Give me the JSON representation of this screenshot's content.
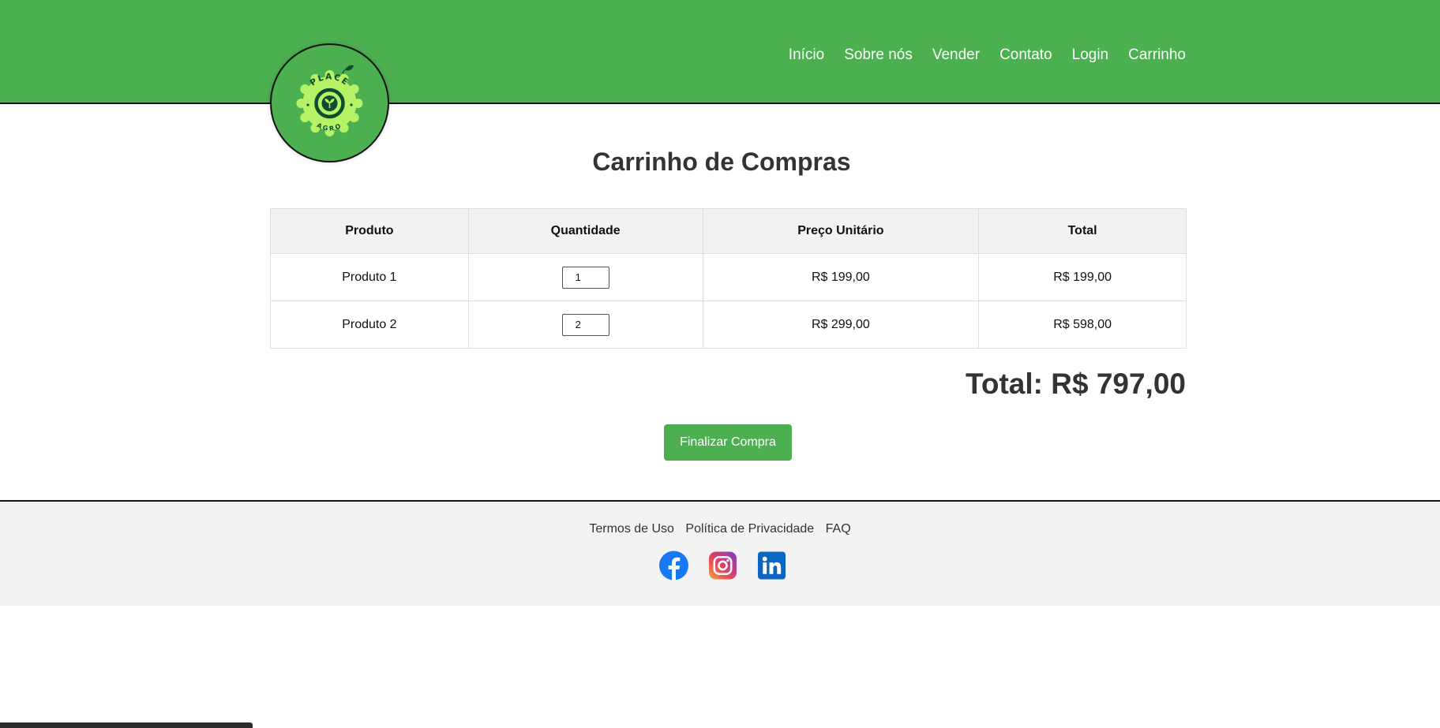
{
  "header": {
    "logo": {
      "top_text": "PLACE",
      "bottom_text": "AGRO",
      "icon": "leaf-logo-icon"
    },
    "nav": [
      "Início",
      "Sobre nós",
      "Vender",
      "Contato",
      "Login",
      "Carrinho"
    ]
  },
  "main": {
    "title": "Carrinho de Compras",
    "table": {
      "headers": [
        "Produto",
        "Quantidade",
        "Preço Unitário",
        "Total"
      ],
      "rows": [
        {
          "product": "Produto 1",
          "quantity": "1",
          "unit_price": "R$ 199,00",
          "total": "R$ 199,00"
        },
        {
          "product": "Produto 2",
          "quantity": "2",
          "unit_price": "R$ 299,00",
          "total": "R$ 598,00"
        }
      ]
    },
    "grand_total": "Total: R$ 797,00",
    "checkout_label": "Finalizar Compra"
  },
  "footer": {
    "links": [
      "Termos de Uso",
      "Política de Privacidade",
      "FAQ"
    ],
    "social": [
      "facebook-icon",
      "instagram-icon",
      "linkedin-icon"
    ]
  },
  "colors": {
    "brand_green": "#4caf50",
    "logo_light_green": "#b6f266",
    "logo_dark_green": "#0f4d2e",
    "footer_bg": "#f3f3f3"
  }
}
